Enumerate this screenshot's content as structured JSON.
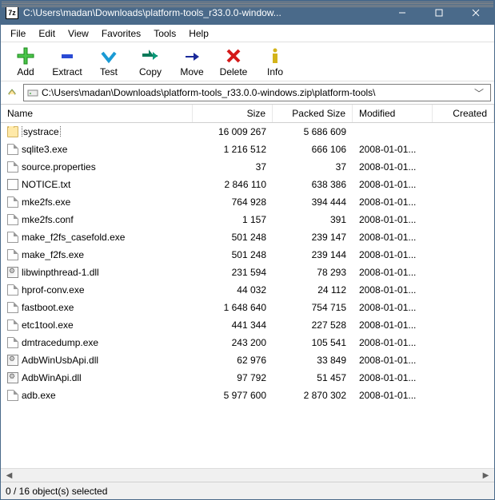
{
  "window": {
    "title": "C:\\Users\\madan\\Downloads\\platform-tools_r33.0.0-window...",
    "app_icon_label": "7z"
  },
  "menu": [
    "File",
    "Edit",
    "View",
    "Favorites",
    "Tools",
    "Help"
  ],
  "toolbar": [
    {
      "key": "add",
      "label": "Add"
    },
    {
      "key": "extract",
      "label": "Extract"
    },
    {
      "key": "test",
      "label": "Test"
    },
    {
      "key": "copy",
      "label": "Copy"
    },
    {
      "key": "move",
      "label": "Move"
    },
    {
      "key": "delete",
      "label": "Delete"
    },
    {
      "key": "info",
      "label": "Info"
    }
  ],
  "address": "C:\\Users\\madan\\Downloads\\platform-tools_r33.0.0-windows.zip\\platform-tools\\",
  "columns": {
    "name": "Name",
    "size": "Size",
    "packed": "Packed Size",
    "modified": "Modified",
    "created": "Created"
  },
  "files": [
    {
      "icon": "folder",
      "name": "systrace",
      "size": "16 009 267",
      "packed": "5 686 609",
      "modified": "",
      "selected": true
    },
    {
      "icon": "file",
      "name": "sqlite3.exe",
      "size": "1 216 512",
      "packed": "666 106",
      "modified": "2008-01-01..."
    },
    {
      "icon": "file",
      "name": "source.properties",
      "size": "37",
      "packed": "37",
      "modified": "2008-01-01..."
    },
    {
      "icon": "txt",
      "name": "NOTICE.txt",
      "size": "2 846 110",
      "packed": "638 386",
      "modified": "2008-01-01..."
    },
    {
      "icon": "file",
      "name": "mke2fs.exe",
      "size": "764 928",
      "packed": "394 444",
      "modified": "2008-01-01..."
    },
    {
      "icon": "file",
      "name": "mke2fs.conf",
      "size": "1 157",
      "packed": "391",
      "modified": "2008-01-01..."
    },
    {
      "icon": "file",
      "name": "make_f2fs_casefold.exe",
      "size": "501 248",
      "packed": "239 147",
      "modified": "2008-01-01..."
    },
    {
      "icon": "file",
      "name": "make_f2fs.exe",
      "size": "501 248",
      "packed": "239 144",
      "modified": "2008-01-01..."
    },
    {
      "icon": "dll",
      "name": "libwinpthread-1.dll",
      "size": "231 594",
      "packed": "78 293",
      "modified": "2008-01-01..."
    },
    {
      "icon": "file",
      "name": "hprof-conv.exe",
      "size": "44 032",
      "packed": "24 112",
      "modified": "2008-01-01..."
    },
    {
      "icon": "file",
      "name": "fastboot.exe",
      "size": "1 648 640",
      "packed": "754 715",
      "modified": "2008-01-01..."
    },
    {
      "icon": "file",
      "name": "etc1tool.exe",
      "size": "441 344",
      "packed": "227 528",
      "modified": "2008-01-01..."
    },
    {
      "icon": "file",
      "name": "dmtracedump.exe",
      "size": "243 200",
      "packed": "105 541",
      "modified": "2008-01-01..."
    },
    {
      "icon": "dll",
      "name": "AdbWinUsbApi.dll",
      "size": "62 976",
      "packed": "33 849",
      "modified": "2008-01-01..."
    },
    {
      "icon": "dll",
      "name": "AdbWinApi.dll",
      "size": "97 792",
      "packed": "51 457",
      "modified": "2008-01-01..."
    },
    {
      "icon": "file",
      "name": "adb.exe",
      "size": "5 977 600",
      "packed": "2 870 302",
      "modified": "2008-01-01..."
    }
  ],
  "status": "0 / 16 object(s) selected"
}
